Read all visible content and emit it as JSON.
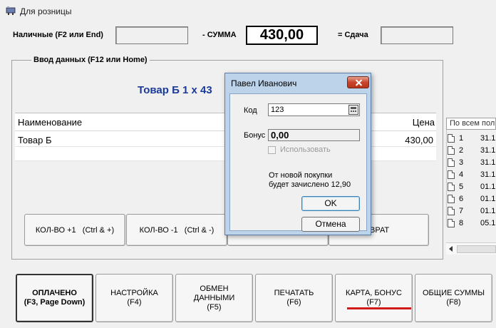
{
  "window": {
    "title": "Для розницы",
    "icon": "register-icon"
  },
  "payment": {
    "cash_label": "Наличные (F2 или End)",
    "cash_value": "",
    "sum_label": "- СУММА",
    "sum_value": "430,00",
    "change_label": "= Сдача",
    "change_value": ""
  },
  "input_group": {
    "legend": "Ввод данных (F12 или Home)",
    "product_title": "Товар Б   1 х 43"
  },
  "grid": {
    "columns": [
      "Наименование",
      "Цена"
    ],
    "rows": [
      {
        "name": "Товар Б",
        "price": "430,00"
      }
    ]
  },
  "qty_buttons": {
    "plus": {
      "label": "КОЛ-ВО +1",
      "shortcut": "(Ctrl & +)"
    },
    "minus": {
      "label": "КОЛ-ВО -1",
      "shortcut": "(Ctrl & -)"
    },
    "return": "ВРАТ"
  },
  "bottom_buttons": [
    {
      "line1": "ОПЛАЧЕНО",
      "line2": "(F3, Page Down)",
      "line3": ""
    },
    {
      "line1": "НАСТРОЙКА",
      "line2": "(F4)",
      "line3": ""
    },
    {
      "line1": "ОБМЕН",
      "line2": "ДАННЫМИ",
      "line3": "(F5)"
    },
    {
      "line1": "ПЕЧАТАТЬ",
      "line2": "(F6)",
      "line3": ""
    },
    {
      "line1": "КАРТА, БОНУС",
      "line2": "(F7)",
      "line3": ""
    },
    {
      "line1": "ОБЩИЕ СУММЫ",
      "line2": "(F8)",
      "line3": ""
    }
  ],
  "history_panel": {
    "filter": "По всем пол",
    "rows": [
      {
        "n": "1",
        "d": "31.1"
      },
      {
        "n": "2",
        "d": "31.1"
      },
      {
        "n": "3",
        "d": "31.1"
      },
      {
        "n": "4",
        "d": "31.1"
      },
      {
        "n": "5",
        "d": "01.1"
      },
      {
        "n": "6",
        "d": "01.1"
      },
      {
        "n": "7",
        "d": "01.1"
      },
      {
        "n": "8",
        "d": "05.1"
      }
    ]
  },
  "dialog": {
    "title": "Павел Иванович",
    "code_label": "Код",
    "code_value": "123",
    "bonus_label": "Бонус",
    "bonus_value": "0,00",
    "use_label": "Использовать",
    "message_line1": "От новой покупки",
    "message_line2": "будет зачислено 12,90",
    "ok_label": "OK",
    "cancel_label": "Отмена"
  },
  "colors": {
    "accent_underline": "#d21a1a",
    "product_title": "#1a3a9a"
  }
}
